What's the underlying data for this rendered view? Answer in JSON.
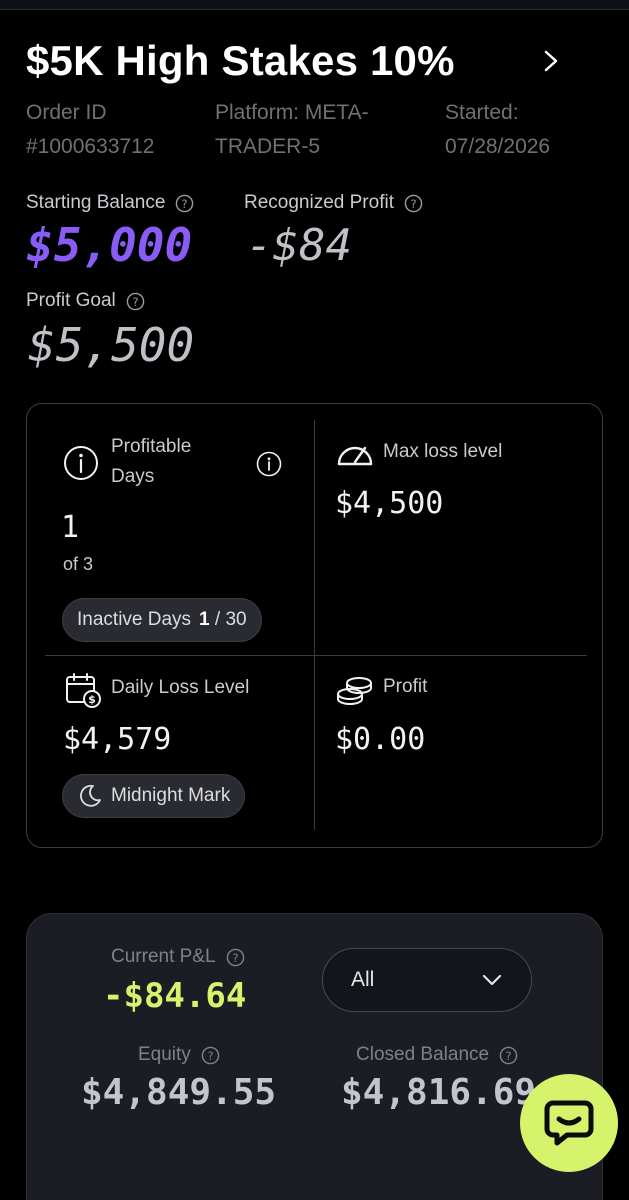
{
  "account": {
    "title": "$5K High Stakes 10%",
    "order_id_label": "Order ID",
    "order_id": "#1000633712",
    "platform_line1": "Platform: META-",
    "platform_line2": "TRADER-5",
    "started_label": "Started:",
    "started_date": "07/28/2026"
  },
  "balances": {
    "starting_label": "Starting Balance",
    "starting_value": "$5,000",
    "profit_label": "Recognized Profit",
    "profit_value": "-$84",
    "goal_label": "Profit Goal",
    "goal_value": "$5,500"
  },
  "stats": {
    "profitable_label_1": "Profitable",
    "profitable_label_2": "Days",
    "profitable_value": "1",
    "profitable_of": "of 3",
    "inactive_label": "Inactive Days",
    "inactive_value": "1",
    "inactive_total": "/ 30",
    "maxloss_label": "Max loss level",
    "maxloss_value": "$4,500",
    "daily_label": "Daily Loss Level",
    "daily_value": "$4,579",
    "midnight_label": "Midnight Mark",
    "profit_label": "Profit",
    "profit_value": "$0.00"
  },
  "pnl": {
    "current_label": "Current P&L",
    "current_value": "-$84.64",
    "filter_value": "All",
    "equity_label": "Equity",
    "equity_value": "$4,849.55",
    "closed_label": "Closed Balance",
    "closed_value": "$4,816.69"
  },
  "colors": {
    "accent_purple": "#8a5cf6",
    "accent_lime": "#d6f36b",
    "background": "#000000"
  }
}
